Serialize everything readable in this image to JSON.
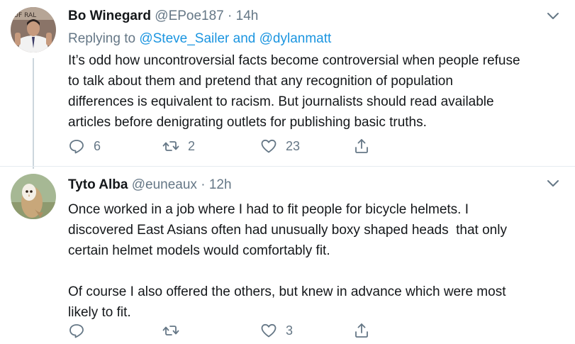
{
  "tweets": [
    {
      "display_name": "Bo Winegard",
      "handle": "@EPoe187",
      "separator": "·",
      "time": "14h",
      "replying_prefix": "Replying to",
      "replying_to": "@Steve_Sailer and @dylanmatt",
      "text": "It’s odd how uncontroversial facts become controversial when people refuse\nto talk about them and pretend that any recognition of population\ndifferences is equivalent to racism. But journalists should read available\narticles before denigrating outlets for publishing basic truths.",
      "replies": "6",
      "retweets": "2",
      "likes": "23",
      "avatar_colors": {
        "bg": "#8a7468",
        "shirt": "#f2f2f2",
        "skin": "#c69a7e"
      }
    },
    {
      "display_name": "Tyto Alba",
      "handle": "@euneaux",
      "separator": "·",
      "time": "12h",
      "text": "Once worked in a job where I had to fit people for bicycle helmets. I\ndiscovered East Asians often had unusually boxy shaped heads  that only\ncertain helmet models would comfortably fit.\n\nOf course I also offered the others, but knew in advance which were most\nlikely to fit.",
      "replies": "",
      "retweets": "",
      "likes": "3",
      "avatar_colors": {
        "bg": "#a6b894",
        "owl": "#c8a77a",
        "face": "#f4efe6"
      }
    }
  ],
  "colors": {
    "text": "#14171a",
    "secondary": "#657786",
    "link": "#1b95e0",
    "divider": "#e6ecf0"
  }
}
